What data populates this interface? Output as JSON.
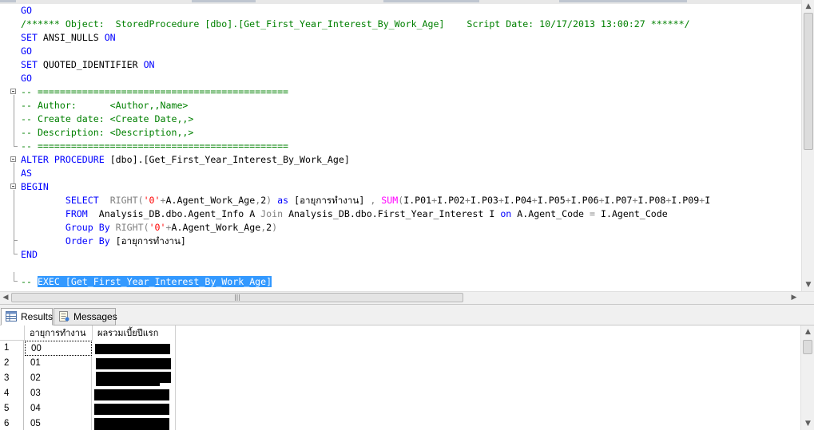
{
  "editor": {
    "lines": [
      [
        {
          "t": "GO",
          "c": "kw"
        }
      ],
      [
        {
          "t": "/****** Object:  StoredProcedure [dbo].[Get_First_Year_Interest_By_Work_Age]    Script Date: 10/17/2013 13:00:27 ******/",
          "c": "cm"
        }
      ],
      [
        {
          "t": "SET ",
          "c": "kw"
        },
        {
          "t": "ANSI_NULLS ",
          "c": ""
        },
        {
          "t": "ON",
          "c": "kw"
        }
      ],
      [
        {
          "t": "GO",
          "c": "kw"
        }
      ],
      [
        {
          "t": "SET ",
          "c": "kw"
        },
        {
          "t": "QUOTED_IDENTIFIER ",
          "c": ""
        },
        {
          "t": "ON",
          "c": "kw"
        }
      ],
      [
        {
          "t": "GO",
          "c": "kw"
        }
      ],
      [
        {
          "t": "-- =============================================",
          "c": "cm"
        }
      ],
      [
        {
          "t": "-- Author:      <Author,,Name>",
          "c": "cm"
        }
      ],
      [
        {
          "t": "-- Create date: <Create Date,,>",
          "c": "cm"
        }
      ],
      [
        {
          "t": "-- Description: <Description,,>",
          "c": "cm"
        }
      ],
      [
        {
          "t": "-- =============================================",
          "c": "cm"
        }
      ],
      [
        {
          "t": "ALTER PROCEDURE ",
          "c": "kw"
        },
        {
          "t": "[dbo].[Get_First_Year_Interest_By_Work_Age]",
          "c": ""
        }
      ],
      [
        {
          "t": "AS",
          "c": "kw"
        }
      ],
      [
        {
          "t": "BEGIN",
          "c": "kw"
        }
      ],
      [
        {
          "t": "        SELECT  ",
          "c": "kw"
        },
        {
          "t": "RIGHT",
          "c": "gray"
        },
        {
          "t": "(",
          "c": "gray"
        },
        {
          "t": "'0'",
          "c": "str"
        },
        {
          "t": "+",
          "c": "gray"
        },
        {
          "t": "A.Agent_Work_Age",
          "c": ""
        },
        {
          "t": ",",
          "c": "gray"
        },
        {
          "t": "2",
          "c": ""
        },
        {
          "t": ") ",
          "c": "gray"
        },
        {
          "t": "as ",
          "c": "kw"
        },
        {
          "t": "[อายุการทำงาน] ",
          "c": ""
        },
        {
          "t": ", ",
          "c": "gray"
        },
        {
          "t": "SUM",
          "c": "fn"
        },
        {
          "t": "(",
          "c": "gray"
        },
        {
          "t": "I.P01",
          "c": ""
        },
        {
          "t": "+",
          "c": "gray"
        },
        {
          "t": "I.P02",
          "c": ""
        },
        {
          "t": "+",
          "c": "gray"
        },
        {
          "t": "I.P03",
          "c": ""
        },
        {
          "t": "+",
          "c": "gray"
        },
        {
          "t": "I.P04",
          "c": ""
        },
        {
          "t": "+",
          "c": "gray"
        },
        {
          "t": "I.P05",
          "c": ""
        },
        {
          "t": "+",
          "c": "gray"
        },
        {
          "t": "I.P06",
          "c": ""
        },
        {
          "t": "+",
          "c": "gray"
        },
        {
          "t": "I.P07",
          "c": ""
        },
        {
          "t": "+",
          "c": "gray"
        },
        {
          "t": "I.P08",
          "c": ""
        },
        {
          "t": "+",
          "c": "gray"
        },
        {
          "t": "I.P09",
          "c": ""
        },
        {
          "t": "+",
          "c": "gray"
        },
        {
          "t": "I",
          "c": ""
        }
      ],
      [
        {
          "t": "        FROM  ",
          "c": "kw"
        },
        {
          "t": "Analysis_DB.dbo.Agent_Info A ",
          "c": ""
        },
        {
          "t": "Join ",
          "c": "gray"
        },
        {
          "t": "Analysis_DB.dbo.First_Year_Interest I ",
          "c": ""
        },
        {
          "t": "on ",
          "c": "kw"
        },
        {
          "t": "A.Agent_Code ",
          "c": ""
        },
        {
          "t": "= ",
          "c": "gray"
        },
        {
          "t": "I.Agent_Code",
          "c": ""
        }
      ],
      [
        {
          "t": "        Group By ",
          "c": "kw"
        },
        {
          "t": "RIGHT",
          "c": "gray"
        },
        {
          "t": "(",
          "c": "gray"
        },
        {
          "t": "'0'",
          "c": "str"
        },
        {
          "t": "+",
          "c": "gray"
        },
        {
          "t": "A.Agent_Work_Age",
          "c": ""
        },
        {
          "t": ",",
          "c": "gray"
        },
        {
          "t": "2",
          "c": ""
        },
        {
          "t": ")",
          "c": "gray"
        }
      ],
      [
        {
          "t": "        Order By ",
          "c": "kw"
        },
        {
          "t": "[อายุการทำงาน]",
          "c": ""
        }
      ],
      [
        {
          "t": "END",
          "c": "kw"
        }
      ],
      [
        {
          "t": "",
          "c": ""
        }
      ],
      [
        {
          "t": "-- ",
          "c": "cm"
        },
        {
          "t": "EXEC [Get_First_Year_Interest_By_Work_Age]",
          "c": "sel"
        }
      ]
    ]
  },
  "results_tabs": {
    "results_label": "Results",
    "messages_label": "Messages"
  },
  "grid": {
    "columns": [
      "อายุการทำงาน",
      "ผลรวมเบี้ยปีแรก"
    ],
    "rows": [
      {
        "num": "1",
        "work_age": "00"
      },
      {
        "num": "2",
        "work_age": "01"
      },
      {
        "num": "3",
        "work_age": "02"
      },
      {
        "num": "4",
        "work_age": "03"
      },
      {
        "num": "5",
        "work_age": "04"
      },
      {
        "num": "6",
        "work_age": "05"
      }
    ]
  }
}
